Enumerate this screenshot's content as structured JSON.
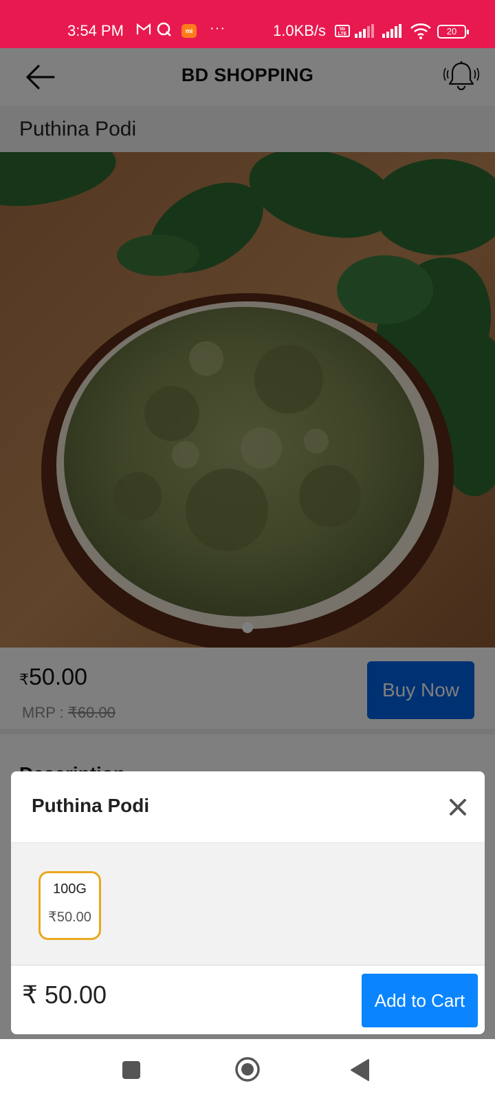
{
  "status_bar": {
    "time": "3:54 PM",
    "network_speed": "1.0KB/s",
    "volte": "Vo LTE",
    "mi_badge": "mi",
    "more": "···",
    "battery": "20",
    "icons": [
      "gmail-icon",
      "search-q-icon",
      "mi-icon",
      "more-dots-icon",
      "volte-icon",
      "signal-icon",
      "signal-icon",
      "wifi-icon",
      "battery-icon"
    ]
  },
  "header": {
    "title": "BD SHOPPING",
    "back_icon": "arrow-left-icon",
    "bell_icon": "bell-ringing-icon"
  },
  "product": {
    "name": "Puthina Podi",
    "price": "50.00",
    "currency": "₹",
    "mrp_label": "MRP :",
    "mrp_value": "₹60.00",
    "buy_now_label": "Buy Now",
    "description_label": "Description",
    "carousel": {
      "count": 1,
      "active": 1
    }
  },
  "modal": {
    "title": "Puthina Podi",
    "close_icon": "close-icon",
    "variants": [
      {
        "size": "100G",
        "price": "₹50.00",
        "selected": true
      }
    ],
    "total": "₹ 50.00",
    "add_to_cart_label": "Add to Cart"
  },
  "colors": {
    "status_bar": "#e8194f",
    "buy_now": "#0062e6",
    "add_to_cart": "#0a84ff",
    "variant_border": "#e8a81e"
  },
  "nav_bar": {
    "icons": [
      "recents-square-icon",
      "home-circle-icon",
      "back-triangle-icon"
    ]
  }
}
